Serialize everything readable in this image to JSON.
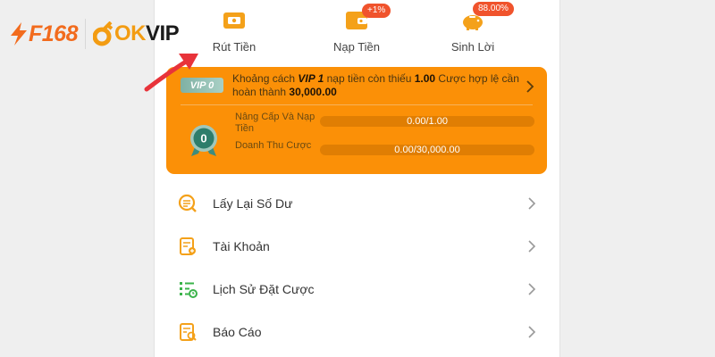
{
  "logos": {
    "brand1": "F168",
    "brand2_ok": "OK",
    "brand2_vip": "VIP"
  },
  "quick_actions": [
    {
      "label": "Rút Tiền",
      "icon": "wallet-card-icon",
      "badge": ""
    },
    {
      "label": "Nạp Tiền",
      "icon": "deposit-wallet-icon",
      "badge": "+1%"
    },
    {
      "label": "Sinh Lời",
      "icon": "piggy-bank-icon",
      "badge": "88.00%"
    }
  ],
  "vip": {
    "current_level": "VIP 0",
    "text_before": "Khoảng cách ",
    "next_level": "VIP 1",
    "text_mid": " nạp tiền còn thiếu ",
    "deposit_missing": "1.00",
    "text_after": " Cược hợp lệ cần hoàn thành ",
    "bet_required": "30,000.00",
    "medal_value": "0",
    "progress": [
      {
        "label": "Nâng Cấp Và Nạp Tiền",
        "value_text": "0.00/1.00",
        "fraction": 0
      },
      {
        "label": "Doanh Thu Cược",
        "value_text": "0.00/30,000.00",
        "fraction": 0
      }
    ]
  },
  "menu": [
    {
      "label": "Lấy Lại Số Dư",
      "icon": "balance-recovery-icon"
    },
    {
      "label": "Tài Khoản",
      "icon": "account-card-icon"
    },
    {
      "label": "Lịch Sử Đặt Cược",
      "icon": "bet-history-icon"
    },
    {
      "label": "Báo Cáo",
      "icon": "report-icon"
    }
  ],
  "colors": {
    "accent": "#fb9007",
    "menu_icon": "#f4a11a",
    "history_icon": "#3ab34a",
    "badge": "#f0532c",
    "arrow": "#e8333a"
  }
}
